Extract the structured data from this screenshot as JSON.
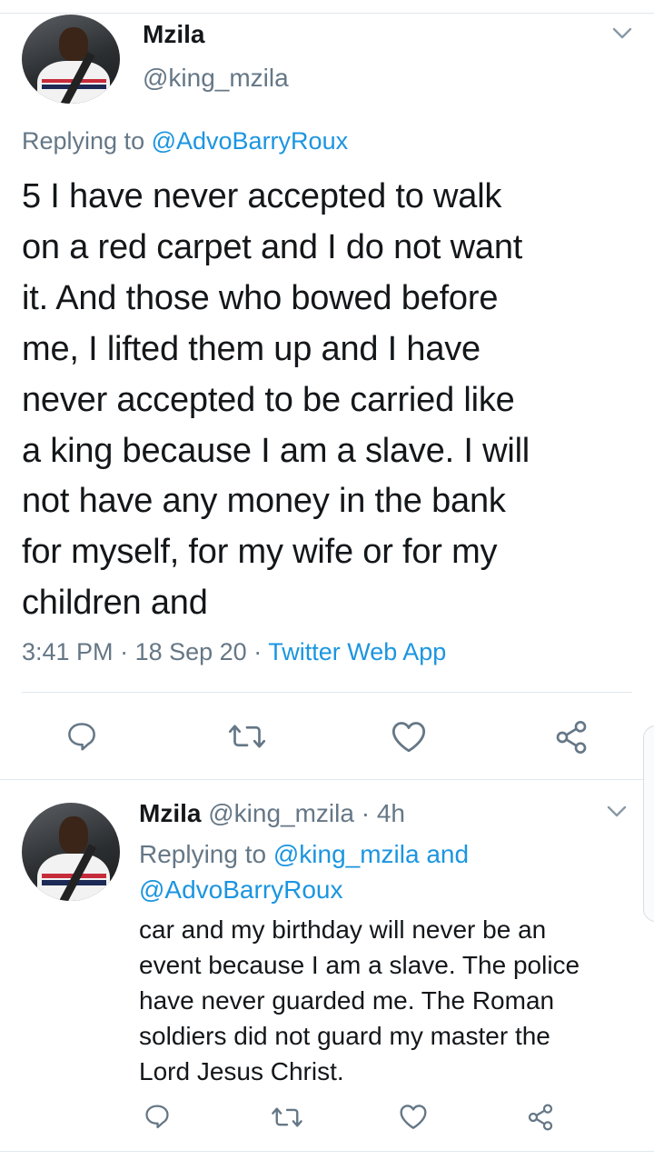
{
  "main_tweet": {
    "name": "Mzila",
    "handle": "@king_mzila",
    "replying_prefix": "Replying to ",
    "replying_to": "@AdvoBarryRoux",
    "text": "5 I have never accepted to walk\non a red carpet and I do not want\nit. And those who bowed before\nme, I lifted them up and I have\nnever accepted to be carried like\na king because I am a slave. I will\nnot have any money in the bank\nfor myself, for my wife or for my\nchildren and",
    "time": "3:41 PM",
    "date": "18 Sep 20",
    "separator": "·",
    "source": "Twitter Web App"
  },
  "reply_tweet": {
    "name": "Mzila",
    "handle": "@king_mzila",
    "separator": "·",
    "age": "4h",
    "replying_prefix": "Replying to ",
    "replying_to_1": "@king_mzila",
    "and_word": " and",
    "replying_to_2": "@AdvoBarryRoux",
    "text": "car and my birthday will never be an\nevent because I am a slave. The police\nhave never guarded me. The Roman\nsoldiers did not guard my master the\nLord Jesus Christ."
  },
  "icons": {
    "reply": "reply-icon",
    "retweet": "retweet-icon",
    "like": "heart-icon",
    "share": "share-icon",
    "menu": "chevron-down-icon"
  },
  "colors": {
    "link": "#1b95e0",
    "muted": "#657786",
    "text": "#14171a",
    "divider": "#e1e8ed"
  }
}
